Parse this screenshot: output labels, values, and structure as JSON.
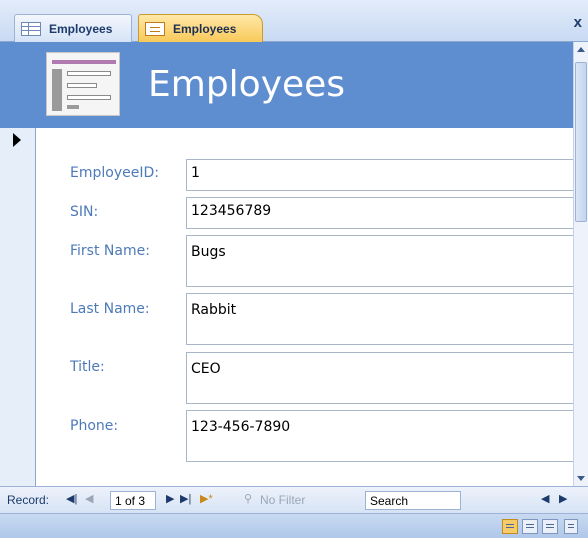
{
  "tabs": [
    {
      "label": "Employees",
      "icon": "table-icon",
      "active": false
    },
    {
      "label": "Employees",
      "icon": "form-icon",
      "active": true
    }
  ],
  "close_label": "x",
  "header": {
    "title": "Employees"
  },
  "fields": [
    {
      "label": "EmployeeID:",
      "value": "1"
    },
    {
      "label": "SIN:",
      "value": "123456789"
    },
    {
      "label": "First Name:",
      "value": "Bugs"
    },
    {
      "label": "Last Name:",
      "value": "Rabbit"
    },
    {
      "label": "Title:",
      "value": "CEO"
    },
    {
      "label": "Phone:",
      "value": "123-456-7890"
    }
  ],
  "nav": {
    "record_label": "Record:",
    "position": "1 of 3",
    "filter_label": "No Filter",
    "search_label": "Search"
  },
  "colors": {
    "header_bg": "#5f8ed0",
    "label_color": "#4d7ab8",
    "active_tab": "#f8c95a"
  }
}
